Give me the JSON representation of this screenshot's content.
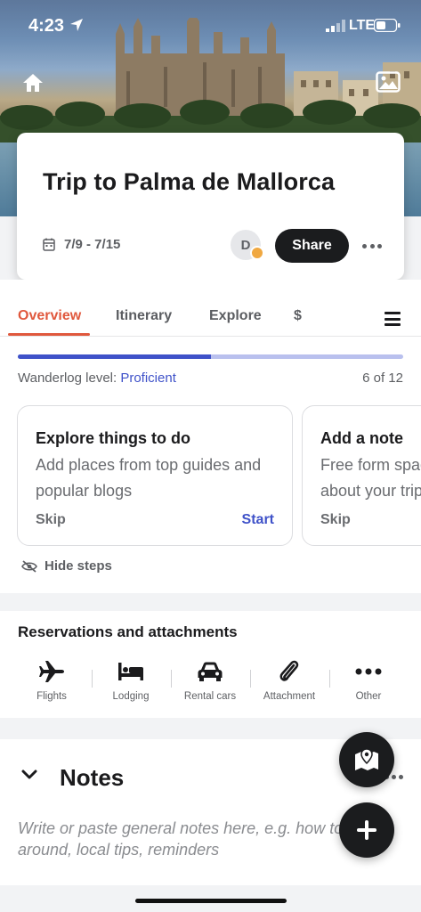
{
  "status_bar": {
    "time": "4:23",
    "network": "LTE"
  },
  "header": {
    "home_icon": "home-icon",
    "photo_icon": "image-icon"
  },
  "trip": {
    "title": "Trip to Palma de Mallorca",
    "dates": "7/9 - 7/15",
    "avatar_initial": "D",
    "share_label": "Share"
  },
  "tabs": [
    "Overview",
    "Itinerary",
    "Explore",
    "$"
  ],
  "progress": {
    "level_label": "Wanderlog level: ",
    "level_value": "Proficient",
    "steps_text": "6 of 12",
    "fraction": 0.5
  },
  "step_cards": [
    {
      "title": "Explore things to do",
      "desc": "Add places from top guides and popular blogs",
      "skip": "Skip",
      "start": "Start"
    },
    {
      "title": "Add a note",
      "desc": "Free form space for anything about your trip",
      "skip": "Skip"
    }
  ],
  "hide_steps_label": "Hide steps",
  "reservations": {
    "title": "Reservations and attachments",
    "items": [
      {
        "label": "Flights",
        "icon": "plane-icon"
      },
      {
        "label": "Lodging",
        "icon": "bed-icon"
      },
      {
        "label": "Rental cars",
        "icon": "car-icon"
      },
      {
        "label": "Attachment",
        "icon": "paperclip-icon"
      },
      {
        "label": "Other",
        "icon": "more-icon"
      }
    ]
  },
  "notes": {
    "title": "Notes",
    "placeholder": "Write or paste general notes here, e.g. how to get around, local tips, reminders"
  },
  "colors": {
    "accent": "#e0583d",
    "primary": "#3f52c9",
    "dark": "#1b1c1e"
  }
}
